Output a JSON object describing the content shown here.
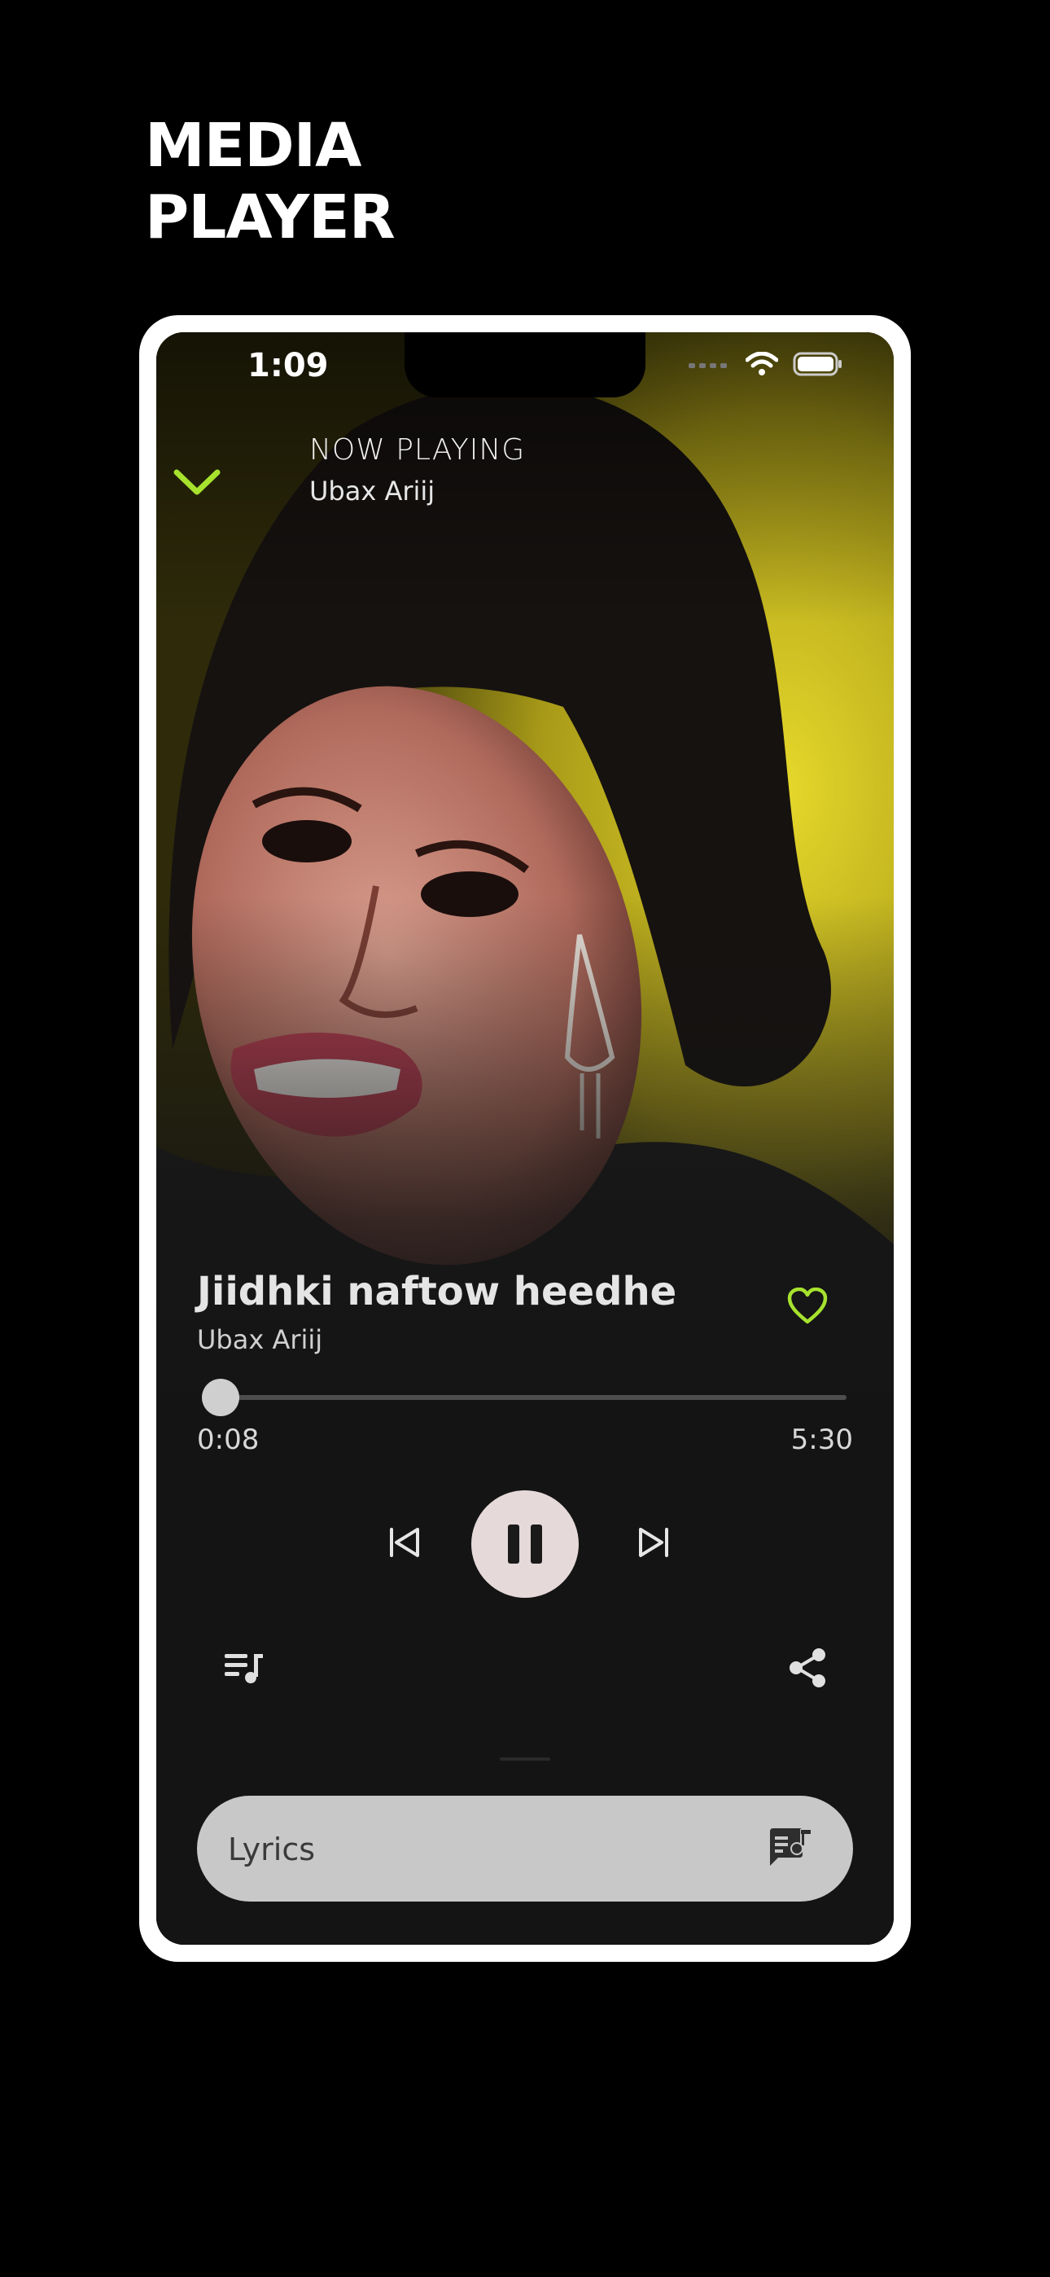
{
  "heading": {
    "line1": "MEDIA",
    "line2": "PLAYER"
  },
  "status_bar": {
    "time": "1:09"
  },
  "header": {
    "label": "NOW PLAYING",
    "artist": "Ubax Ariij"
  },
  "track": {
    "title": "Jiidhki naftow heedhe",
    "artist": "Ubax Ariij",
    "elapsed": "0:08",
    "duration": "5:30",
    "progress_fraction": 0.024
  },
  "lyrics": {
    "label": "Lyrics"
  },
  "colors": {
    "accent": "#a6e22e",
    "background": "#000000",
    "player_bg": "#141414",
    "play_button_bg": "#e6d9d9",
    "lyrics_bar_bg": "#c8c8c8",
    "artwork_backdrop": "#d9cc1f"
  },
  "icons": {
    "collapse": "chevron-down-icon",
    "favorite": "heart-icon",
    "previous": "skip-previous-icon",
    "play_pause": "pause-icon",
    "next": "skip-next-icon",
    "queue": "queue-music-icon",
    "share": "share-icon",
    "lyrics": "lyrics-icon"
  }
}
